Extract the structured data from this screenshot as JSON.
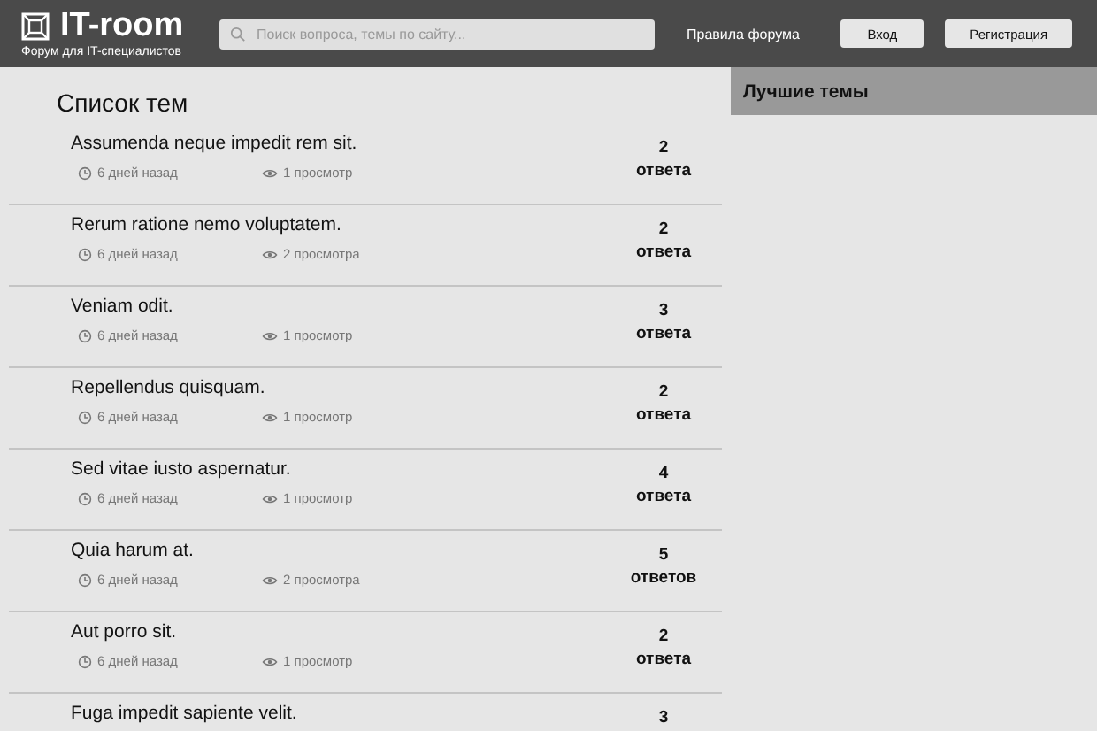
{
  "header": {
    "logo": "IT-room",
    "tagline": "Форум для IT-специалистов",
    "search": {
      "placeholder": "Поиск вопроса, темы по сайту..."
    },
    "rules_link": "Правила форума",
    "buttons": [
      "Вход",
      "Регистрация"
    ]
  },
  "topics_title": "Список тем",
  "topics": [
    {
      "title": "Assumenda neque impedit rem sit.",
      "time": "6 дней назад",
      "views": "1 просмотр",
      "count": "2",
      "count_label": "ответа"
    },
    {
      "title": "Rerum ratione nemo voluptatem.",
      "time": "6 дней назад",
      "views": "2 просмотра",
      "count": "2",
      "count_label": "ответа"
    },
    {
      "title": "Veniam odit.",
      "time": "6 дней назад",
      "views": "1 просмотр",
      "count": "3",
      "count_label": "ответа"
    },
    {
      "title": "Repellendus quisquam.",
      "time": "6 дней назад",
      "views": "1 просмотр",
      "count": "2",
      "count_label": "ответа"
    },
    {
      "title": "Sed vitae iusto aspernatur.",
      "time": "6 дней назад",
      "views": "1 просмотр",
      "count": "4",
      "count_label": "ответа"
    },
    {
      "title": "Quia harum at.",
      "time": "6 дней назад",
      "views": "2 просмотра",
      "count": "5",
      "count_label": "ответов"
    },
    {
      "title": "Aut porro sit.",
      "time": "6 дней назад",
      "views": "1 просмотр",
      "count": "2",
      "count_label": "ответа"
    },
    {
      "title": "Fuga impedit sapiente velit.",
      "count": "3"
    }
  ],
  "sidebar": {
    "title": "Лучшие темы"
  }
}
